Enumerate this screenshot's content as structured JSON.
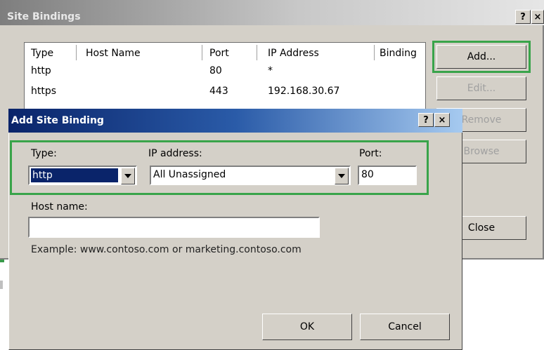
{
  "parent": {
    "title": "Site Bindings",
    "help_glyph": "?",
    "close_glyph": "×",
    "columns": [
      "Type",
      "Host Name",
      "Port",
      "IP Address",
      "Binding"
    ],
    "rows": [
      {
        "type": "http",
        "host": "",
        "port": "80",
        "ip": "*"
      },
      {
        "type": "https",
        "host": "",
        "port": "443",
        "ip": "192.168.30.67"
      }
    ],
    "buttons": {
      "add": "Add...",
      "edit": "Edit...",
      "remove": "Remove",
      "browse": "Browse",
      "close": "Close"
    }
  },
  "dialog": {
    "title": "Add Site Binding",
    "help_glyph": "?",
    "close_glyph": "×",
    "type_label": "Type:",
    "type_value": "http",
    "ip_label": "IP address:",
    "ip_value": "All Unassigned",
    "port_label": "Port:",
    "port_value": "80",
    "host_label": "Host name:",
    "host_value": "",
    "example": "Example: www.contoso.com or marketing.contoso.com",
    "ok_label": "OK",
    "cancel_label": "Cancel"
  },
  "colors": {
    "highlight": "#39a44a",
    "dialog_title_start": "#0a246a",
    "selection": "#0a246a"
  }
}
